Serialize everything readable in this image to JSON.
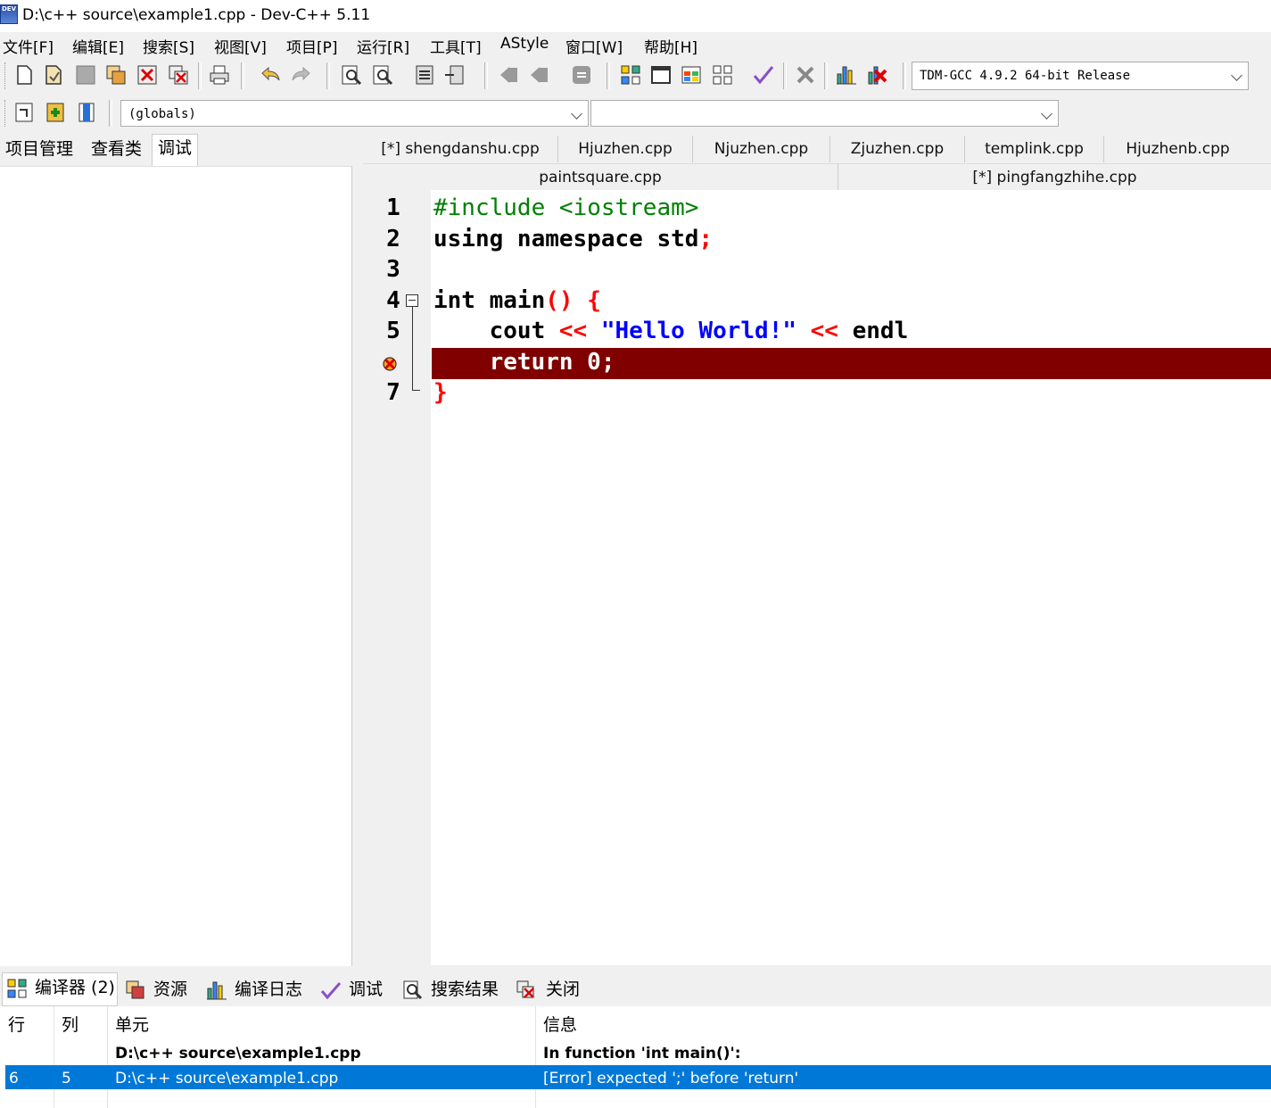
{
  "window": {
    "title": "D:\\c++ source\\example1.cpp - Dev-C++ 5.11",
    "icon_text": "DEV"
  },
  "menu": [
    "文件[F]",
    "编辑[E]",
    "搜索[S]",
    "视图[V]",
    "项目[P]",
    "运行[R]",
    "工具[T]",
    "AStyle",
    "窗口[W]",
    "帮助[H]"
  ],
  "toolbar": {
    "compiler_select": "TDM-GCC 4.9.2 64-bit Release",
    "scope_select": "(globals)",
    "member_select": ""
  },
  "left_tabs": [
    "项目管理",
    "查看类",
    "调试"
  ],
  "editor_tabs_row1": [
    "[*] shengdanshu.cpp",
    "Hjuzhen.cpp",
    "Njuzhen.cpp",
    "Zjuzhen.cpp",
    "templink.cpp",
    "Hjuzhenb.cpp"
  ],
  "editor_tabs_row2": [
    "paintsquare.cpp",
    "[*] pingfangzhihe.cpp"
  ],
  "editor": {
    "line_numbers": [
      "1",
      "2",
      "3",
      "4",
      "5",
      "7"
    ],
    "code": {
      "l1_directive": "#include",
      "l1_header": " <iostream>",
      "l2_text": "using namespace std",
      "l2_semi": ";",
      "l4_text": "int main",
      "l4_paren": "()",
      "l4_brace": " {",
      "l5_cout": "    cout ",
      "l5_op1": "<<",
      "l5_string": " \"Hello World!\" ",
      "l5_op2": "<<",
      "l5_endl": " endl",
      "l6_text": "    return 0;",
      "l7_brace": "}"
    }
  },
  "bottom_tabs": [
    "编译器 (2)",
    "资源",
    "编译日志",
    "调试",
    "搜索结果",
    "关闭"
  ],
  "messages": {
    "headers": [
      "行",
      "列",
      "单元",
      "信息"
    ],
    "rows": [
      {
        "line": "",
        "col": "",
        "unit": "D:\\c++ source\\example1.cpp",
        "message": "In function 'int main()':"
      },
      {
        "line": "6",
        "col": "5",
        "unit": "D:\\c++ source\\example1.cpp",
        "message": "[Error] expected ';' before 'return'"
      }
    ]
  }
}
